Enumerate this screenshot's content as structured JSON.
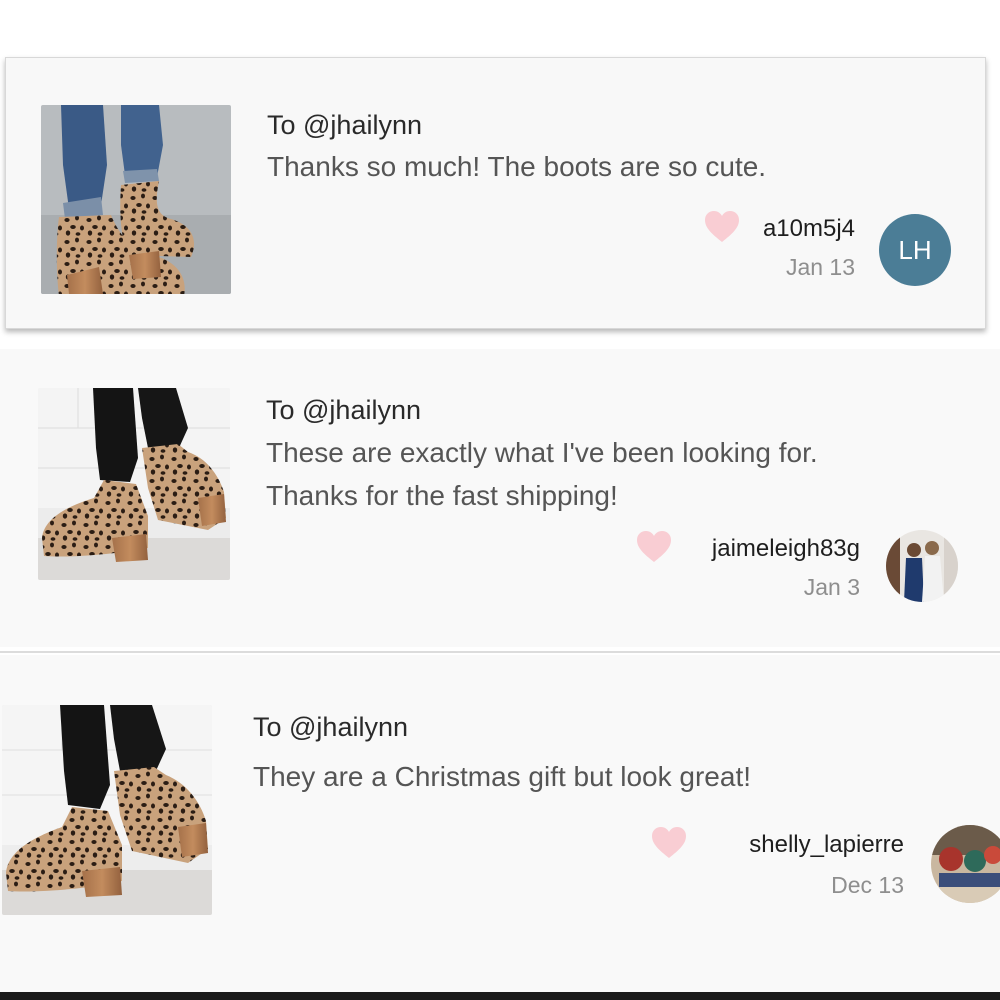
{
  "reviews": [
    {
      "to": "To @jhailynn",
      "message_lines": [
        "Thanks so much! The boots are so cute."
      ],
      "username": "a10m5j4",
      "date": "Jan 13",
      "avatar_initials": "LH",
      "avatar_color": "#4b7d96"
    },
    {
      "to": "To @jhailynn",
      "message_lines": [
        "These are exactly what I've been looking for.",
        "Thanks for the fast shipping!"
      ],
      "username": "jaimeleigh83g",
      "date": "Jan 3",
      "avatar_image": "photo-avatar"
    },
    {
      "to": "To @jhailynn",
      "message_lines": [
        "They are a Christmas gift but look great!"
      ],
      "username": "shelly_lapierre",
      "date": "Dec 13",
      "avatar_image": "photo-avatar"
    }
  ],
  "colors": {
    "heart": "#f9cdd3",
    "card_background": "#f8f8f8",
    "username": "#1e1e1e",
    "date": "#8e8e8e"
  },
  "icons": {
    "heart": "heart-icon"
  }
}
